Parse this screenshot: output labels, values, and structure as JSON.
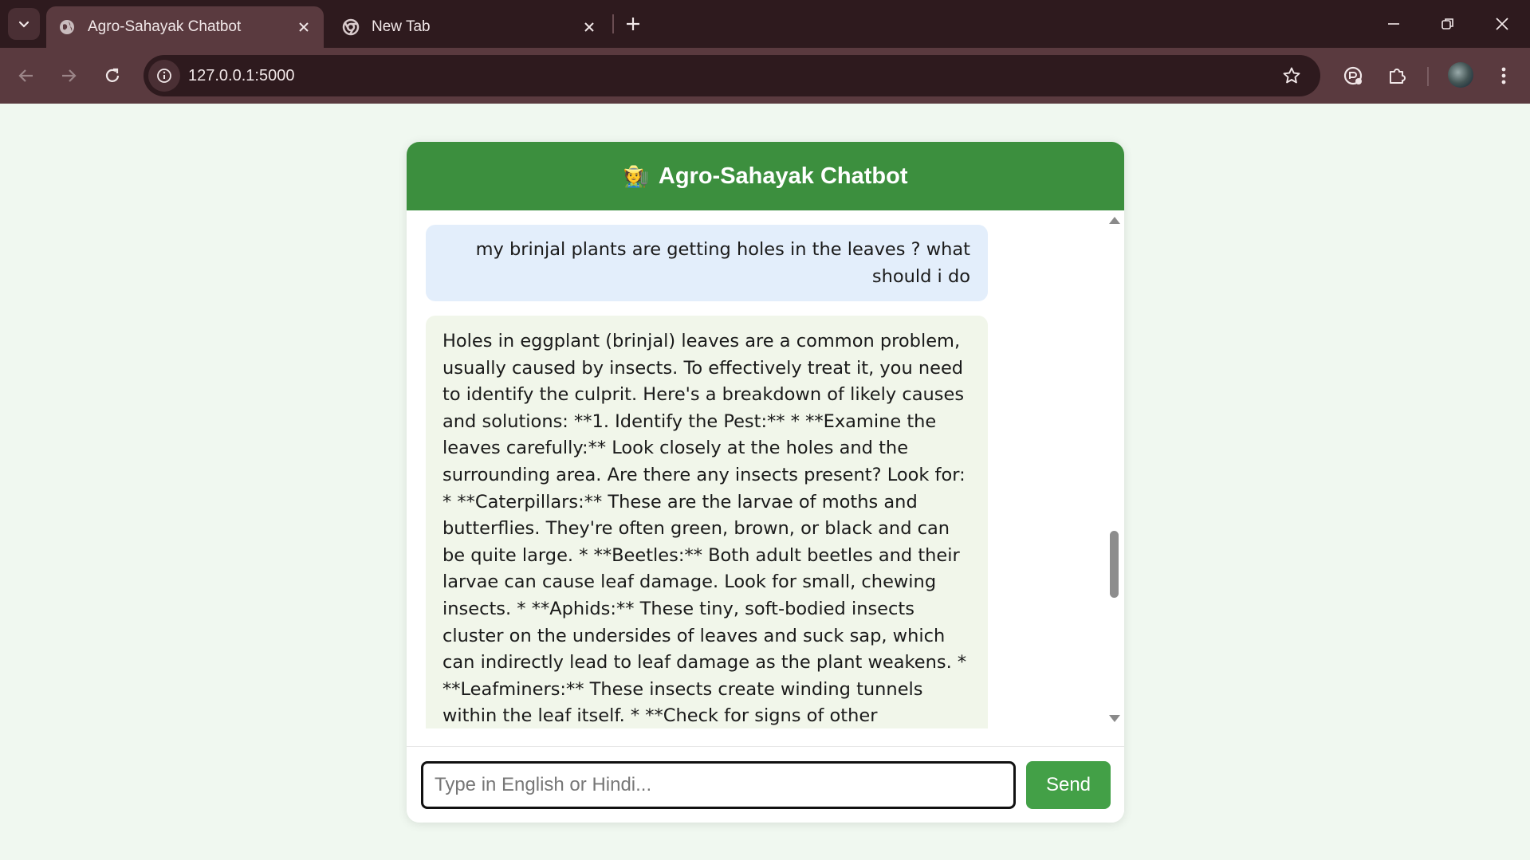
{
  "browser": {
    "tabs": [
      {
        "title": "Agro-Sahayak Chatbot",
        "active": true
      },
      {
        "title": "New Tab",
        "active": false
      }
    ],
    "url": "127.0.0.1:5000"
  },
  "chat": {
    "header_emoji": "🧑‍🌾",
    "title": "Agro-Sahayak Chatbot",
    "messages": {
      "user": "my brinjal plants are getting holes in the leaves ? what should i do",
      "bot": "Holes in eggplant (brinjal) leaves are a common problem, usually caused by insects. To effectively treat it, you need to identify the culprit. Here's a breakdown of likely causes and solutions: **1. Identify the Pest:** * **Examine the leaves carefully:** Look closely at the holes and the surrounding area. Are there any insects present? Look for: * **Caterpillars:** These are the larvae of moths and butterflies. They're often green, brown, or black and can be quite large. * **Beetles:** Both adult beetles and their larvae can cause leaf damage. Look for small, chewing insects. * **Aphids:** These tiny, soft-bodied insects cluster on the undersides of leaves and suck sap, which can indirectly lead to leaf damage as the plant weakens. * **Leafminers:** These insects create winding tunnels within the leaf itself. * **Check for signs of other damage:** Are the holes ragged or neat? Ragged holes suggest chewing insects, while more precise holes might"
    },
    "input_placeholder": "Type in English or Hindi...",
    "send_label": "Send"
  }
}
